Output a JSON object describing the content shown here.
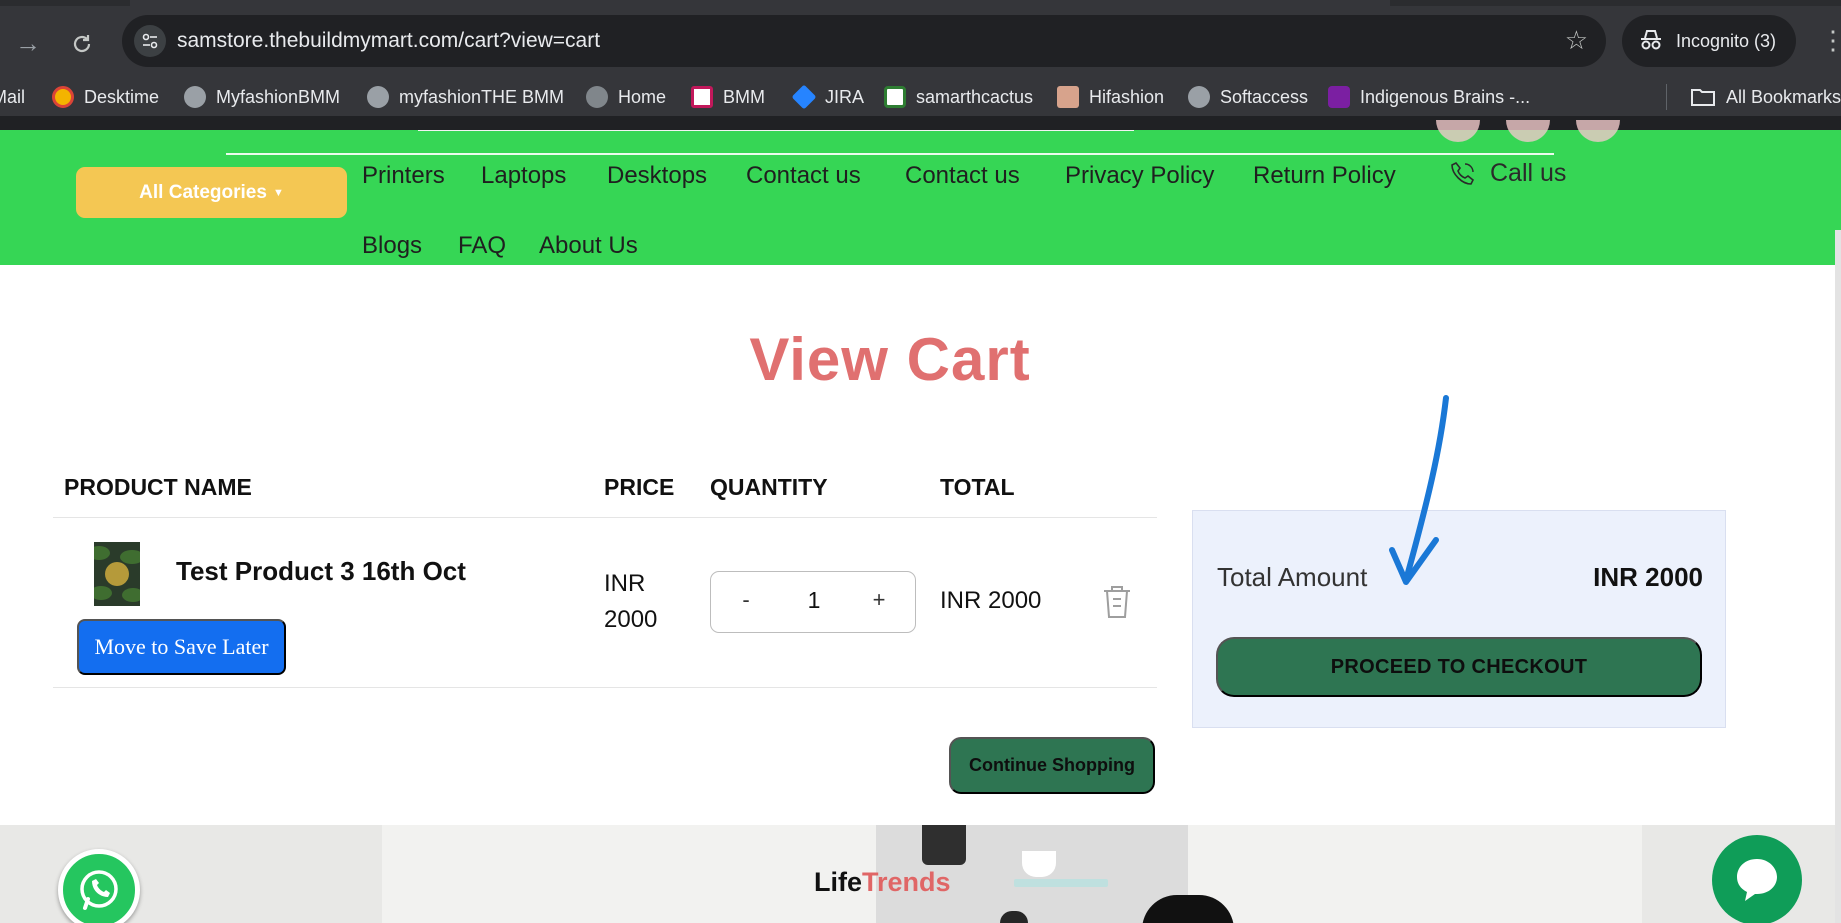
{
  "browser": {
    "url": "samstore.thebuildmymart.com/cart?view=cart",
    "incognito_label": "Incognito (3)",
    "bookmarks": [
      {
        "label": "Mail",
        "color": "#ea4335"
      },
      {
        "label": "Desktime",
        "color": "#f4b400"
      },
      {
        "label": "MyfashionBMM",
        "color": "#9aa0a6"
      },
      {
        "label": "myfashionTHE BMM",
        "color": "#9aa0a6"
      },
      {
        "label": "Home",
        "color": "#80868b"
      },
      {
        "label": "BMM",
        "color": "#c2185b"
      },
      {
        "label": "JIRA",
        "color": "#2684ff"
      },
      {
        "label": "samarthcactus",
        "color": "#2e7d32"
      },
      {
        "label": "Hifashion",
        "color": "#d7a38c"
      },
      {
        "label": "Softaccess",
        "color": "#9aa0a6"
      },
      {
        "label": "Indigenous Brains -...",
        "color": "#7b1fa2"
      }
    ],
    "all_bookmarks": "All Bookmarks"
  },
  "nav": {
    "categories_label": "All Categories",
    "links": [
      "Printers",
      "Laptops",
      "Desktops",
      "Contact us",
      "Contact us",
      "Privacy Policy",
      "Return Policy"
    ],
    "links_row2": [
      "Blogs",
      "FAQ",
      "About Us"
    ],
    "call_label": "Call us",
    "accent_color": "#36d655"
  },
  "cart": {
    "title": "View Cart",
    "headers": {
      "product": "PRODUCT NAME",
      "price": "PRICE",
      "quantity": "QUANTITY",
      "total": "TOTAL"
    },
    "items": [
      {
        "name": "Test Product 3 16th Oct",
        "price_line1": "INR",
        "price_line2": "2000",
        "quantity": "1",
        "total": "INR 2000",
        "save_later_label": "Move to Save Later",
        "minus": "-",
        "plus": "+"
      }
    ],
    "continue_label": "Continue Shopping"
  },
  "summary": {
    "total_label": "Total Amount",
    "total_value": "INR 2000",
    "checkout_label": "PROCEED TO CHECKOUT"
  },
  "footer": {
    "brand_part1": "Life",
    "brand_part2": "Trends"
  }
}
